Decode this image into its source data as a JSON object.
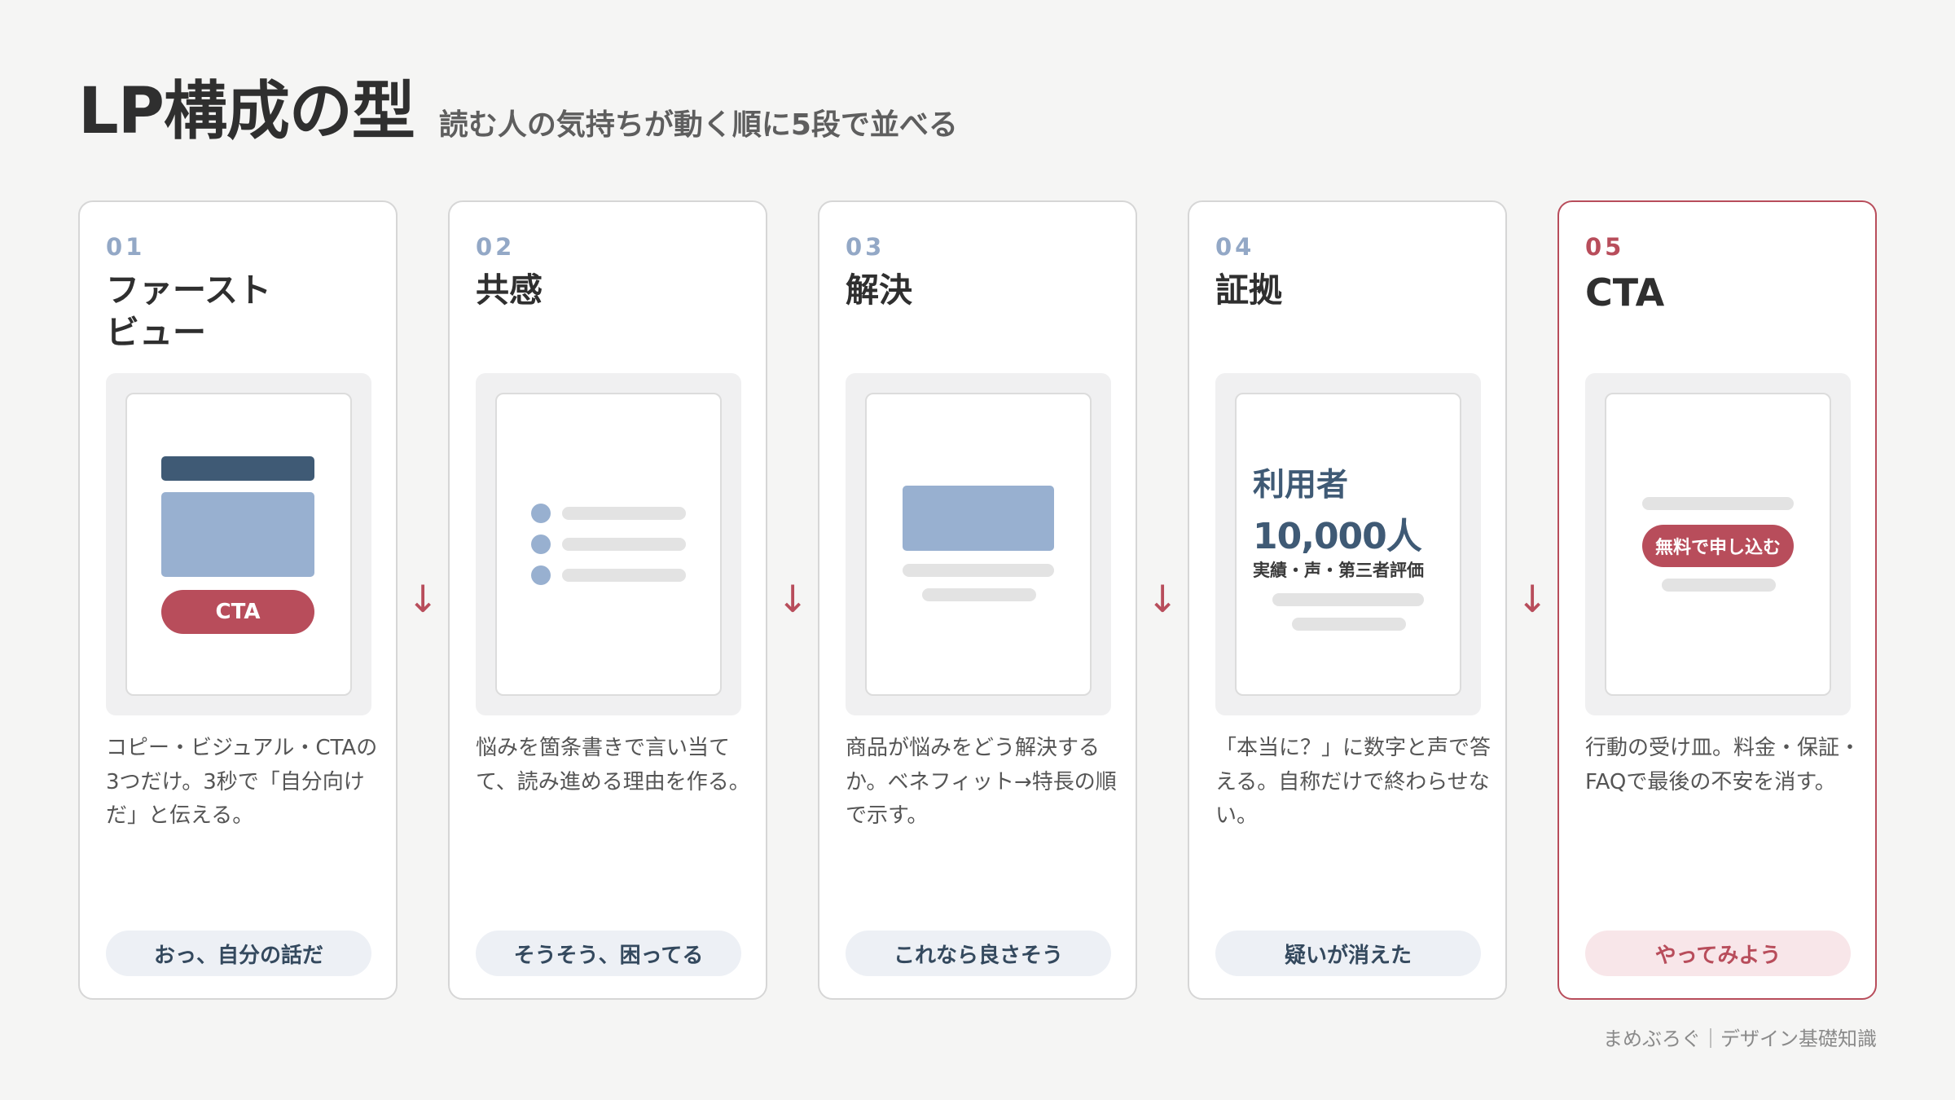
{
  "header": {
    "title": "LP構成の型",
    "subtitle": "読む人の気持ちが動く順に5段で並べる"
  },
  "cards": [
    {
      "num": "01",
      "title": "ファースト\nビュー",
      "desc": "コピー・ビジュアル・CTAの3つだけ。3秒で「自分向けだ」と伝える。",
      "reaction": "おっ、自分の話だ",
      "mock": {
        "cta_label": "CTA"
      }
    },
    {
      "num": "02",
      "title": "共感",
      "desc": "悩みを箇条書きで言い当てて、読み進める理由を作る。",
      "reaction": "そうそう、困ってる"
    },
    {
      "num": "03",
      "title": "解決",
      "desc": "商品が悩みをどう解決するか。ベネフィット→特長の順で示す。",
      "reaction": "これなら良さそう"
    },
    {
      "num": "04",
      "title": "証拠",
      "desc": "「本当に？」に数字と声で答える。自称だけで終わらせない。",
      "reaction": "疑いが消えた",
      "mock": {
        "line1": "利用者",
        "line2": "10,000人",
        "line3": "実績・声・第三者評価"
      }
    },
    {
      "num": "05",
      "title": "CTA",
      "desc": "行動の受け皿。料金・保証・FAQで最後の不安を消す。",
      "reaction": "やってみよう",
      "mock": {
        "button_label": "無料で申し込む"
      }
    }
  ],
  "arrow_glyph": "↓",
  "footer": "まめぶろぐ｜デザイン基礎知識",
  "colors": {
    "accent": "#b84d5b",
    "navy": "#3f5a75",
    "blue_light": "#98b0d0",
    "background": "#f5f5f4"
  }
}
